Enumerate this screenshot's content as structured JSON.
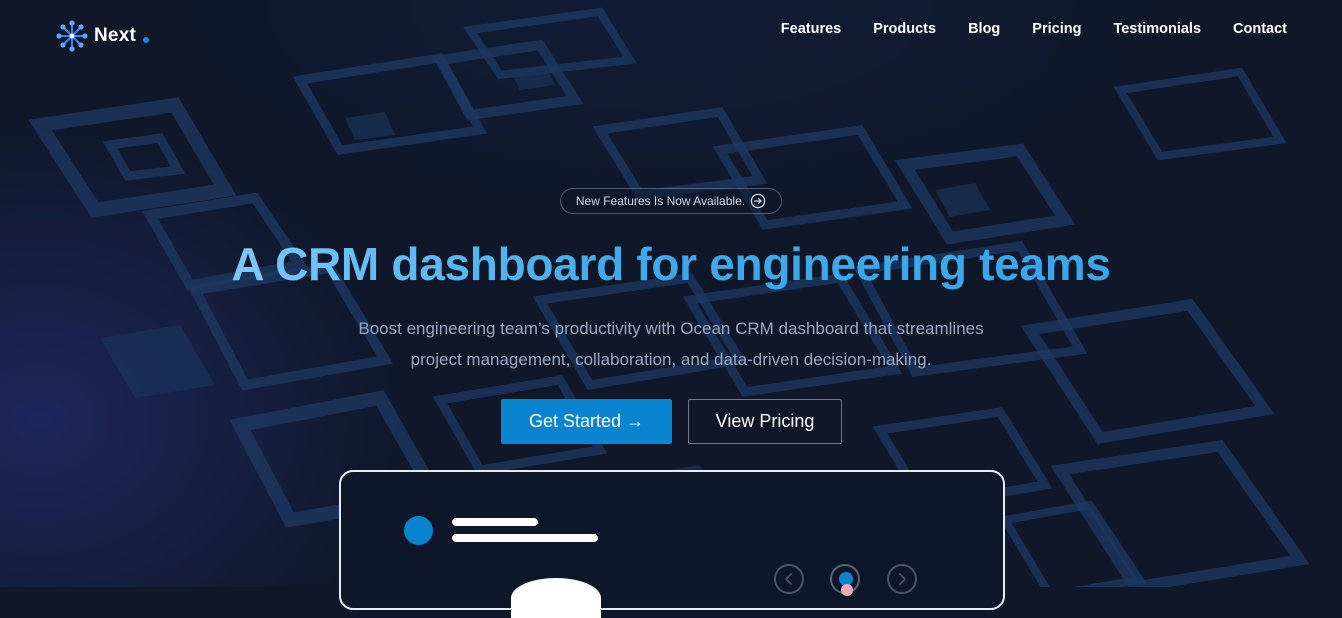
{
  "brand": {
    "name": "Next"
  },
  "nav": {
    "items": [
      {
        "label": "Features"
      },
      {
        "label": "Products"
      },
      {
        "label": "Blog"
      },
      {
        "label": "Pricing"
      },
      {
        "label": "Testimonials"
      },
      {
        "label": "Contact"
      }
    ]
  },
  "hero": {
    "badge": "New Features Is Now Available.",
    "title": "A CRM dashboard for engineering teams",
    "subtitle_line1": "Boost engineering team’s productivity with Ocean CRM dashboard that streamlines",
    "subtitle_line2": "project management, collaboration, and data-driven decision-making.",
    "primary_cta": "Get Started →",
    "secondary_cta": "View Pricing"
  },
  "colors": {
    "background": "#0f1729",
    "accent": "#0b84cf",
    "title_gradient_start": "#7cc8f4",
    "title_gradient_end": "#3aa6e8"
  },
  "icons": [
    "logo-snowflake-icon",
    "arrow-circle-right-icon",
    "chevron-left-icon",
    "chevron-right-icon"
  ]
}
